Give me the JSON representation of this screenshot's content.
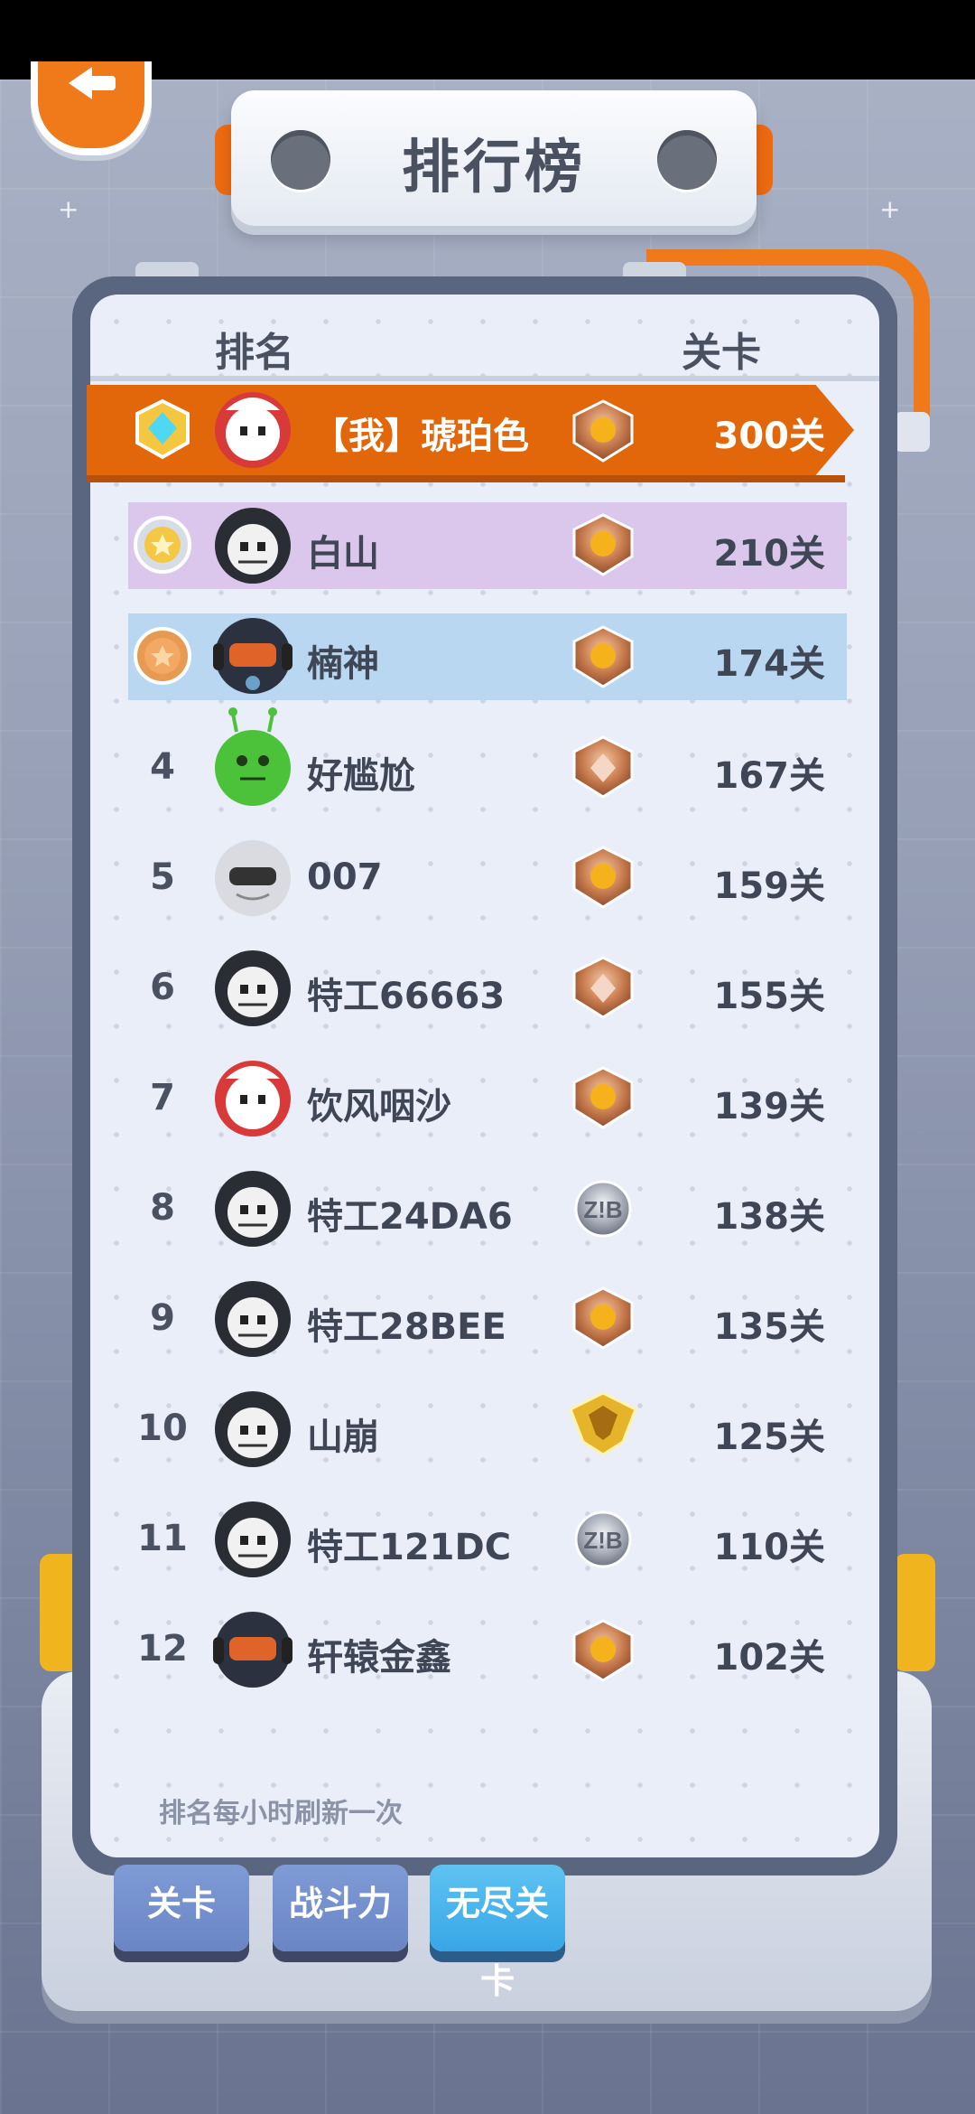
{
  "title": "排行榜",
  "columns": {
    "rank": "排名",
    "level": "关卡"
  },
  "my_entry": {
    "name": "【我】琥珀色",
    "level": "300关"
  },
  "entries": [
    {
      "rank": "",
      "name": "白山",
      "level": "210关",
      "medal": "silver"
    },
    {
      "rank": "",
      "name": "楠神",
      "level": "174关",
      "medal": "bronze"
    },
    {
      "rank": "4",
      "name": "好尴尬",
      "level": "167关"
    },
    {
      "rank": "5",
      "name": "007",
      "level": "159关"
    },
    {
      "rank": "6",
      "name": "特工66663",
      "level": "155关"
    },
    {
      "rank": "7",
      "name": "饮风咽沙",
      "level": "139关"
    },
    {
      "rank": "8",
      "name": "特工24DA6",
      "level": "138关"
    },
    {
      "rank": "9",
      "name": "特工28BEE",
      "level": "135关"
    },
    {
      "rank": "10",
      "name": "山崩",
      "level": "125关"
    },
    {
      "rank": "11",
      "name": "特工121DC",
      "level": "110关"
    },
    {
      "rank": "12",
      "name": "轩辕金鑫",
      "level": "102关"
    }
  ],
  "footnote": "排名每小时刷新一次",
  "tabs": {
    "level": "关卡",
    "power": "战斗力",
    "endless": "无尽关卡"
  },
  "colors": {
    "accent": "#e2670b",
    "pink_row": "#dcc7ec",
    "blue_row": "#b9d7f0"
  }
}
